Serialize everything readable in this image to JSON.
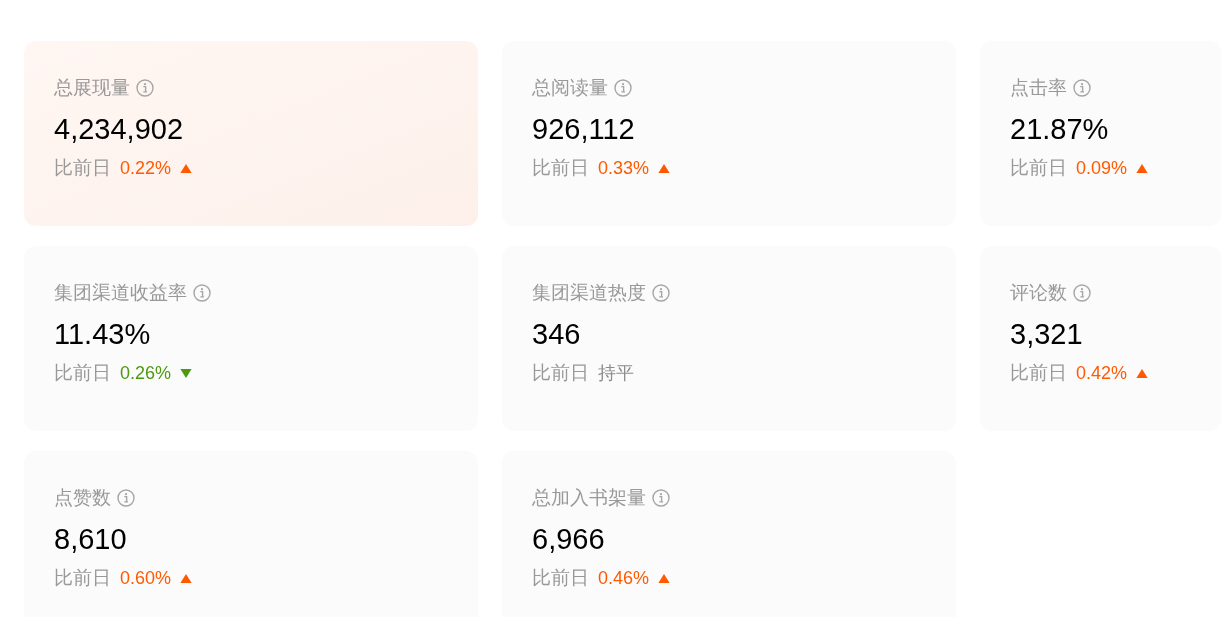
{
  "metrics": [
    {
      "label": "总展现量",
      "value": "4,234,902",
      "compare_label": "比前日",
      "change": "0.22%",
      "kind": "up",
      "selected": true
    },
    {
      "label": "总阅读量",
      "value": "926,112",
      "compare_label": "比前日",
      "change": "0.33%",
      "kind": "up",
      "selected": false
    },
    {
      "label": "点击率",
      "value": "21.87%",
      "compare_label": "比前日",
      "change": "0.09%",
      "kind": "up",
      "selected": false
    },
    {
      "label": "集团渠道收益率",
      "value": "11.43%",
      "compare_label": "比前日",
      "change": "0.26%",
      "kind": "down",
      "selected": false
    },
    {
      "label": "集团渠道热度",
      "value": "346",
      "compare_label": "比前日",
      "change": "持平",
      "kind": "flat",
      "selected": false
    },
    {
      "label": "评论数",
      "value": "3,321",
      "compare_label": "比前日",
      "change": "0.42%",
      "kind": "up",
      "selected": false
    },
    {
      "label": "点赞数",
      "value": "8,610",
      "compare_label": "比前日",
      "change": "0.60%",
      "kind": "up",
      "selected": false
    },
    {
      "label": "总加入书架量",
      "value": "6,966",
      "compare_label": "比前日",
      "change": "0.46%",
      "kind": "up",
      "selected": false
    }
  ]
}
